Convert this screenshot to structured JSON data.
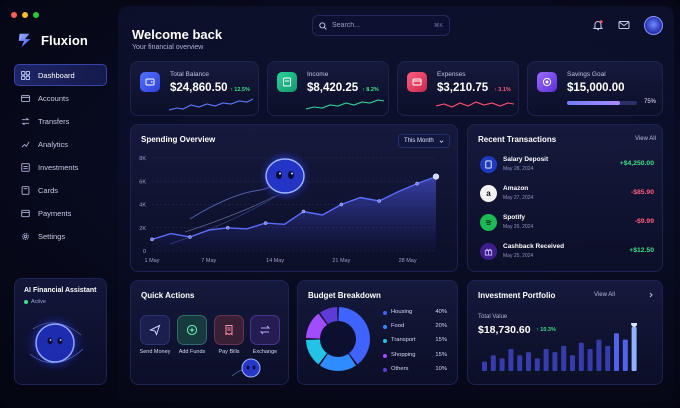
{
  "app": {
    "name": "Fluxion"
  },
  "header": {
    "welcome": "Welcome back",
    "subtitle": "Your financial overview",
    "search_placeholder": "Search...",
    "search_shortcut": "⌘K"
  },
  "sidebar": {
    "items": [
      {
        "label": "Dashboard",
        "icon": "grid-icon",
        "active": true
      },
      {
        "label": "Accounts",
        "icon": "wallet-icon"
      },
      {
        "label": "Transfers",
        "icon": "transfer-icon"
      },
      {
        "label": "Analytics",
        "icon": "chart-icon"
      },
      {
        "label": "Investments",
        "icon": "list-icon"
      },
      {
        "label": "Cards",
        "icon": "card-icon"
      },
      {
        "label": "Payments",
        "icon": "receipt-icon"
      },
      {
        "label": "Settings",
        "icon": "gear-icon"
      }
    ],
    "assistant": {
      "title": "AI Financial Assistant",
      "status": "Active"
    }
  },
  "stats": {
    "total_balance": {
      "label": "Total Balance",
      "value": "$24,860.50",
      "change": "↑ 12.5%",
      "color": "#3b5bff"
    },
    "income": {
      "label": "Income",
      "value": "$8,420.25",
      "change": "↑ 8.2%",
      "color": "#1fb98a"
    },
    "expenses": {
      "label": "Expenses",
      "value": "$3,210.75",
      "change": "↑ 3.1%",
      "color": "#e8486c"
    },
    "savings": {
      "label": "Savings Goal",
      "value": "$15,000.00",
      "percent_text": "75%",
      "progress": 0.75,
      "color": "#7a4cff"
    }
  },
  "spending": {
    "title": "Spending Overview",
    "period": "This Month",
    "chart_data": {
      "type": "area",
      "y_ticks": [
        "0",
        "2K",
        "4K",
        "6K",
        "8K"
      ],
      "x_ticks": [
        "1 May",
        "7 May",
        "14 May",
        "21 May",
        "28 May"
      ],
      "ylim": [
        0,
        8000
      ],
      "x": [
        1,
        3,
        5,
        7,
        9,
        11,
        13,
        15,
        17,
        19,
        21,
        23,
        25,
        27,
        29,
        31
      ],
      "values": [
        1000,
        1500,
        1200,
        1800,
        2000,
        1900,
        2400,
        2300,
        3400,
        3100,
        4000,
        4600,
        4300,
        5100,
        5800,
        6400
      ]
    }
  },
  "transactions": {
    "title": "Recent Transactions",
    "view_all": "View All",
    "items": [
      {
        "name": "Salary Deposit",
        "date": "May 28, 2024",
        "amount": "+$4,250.00",
        "positive": true,
        "icon": "bank-icon"
      },
      {
        "name": "Amazon",
        "date": "May 27, 2024",
        "amount": "-$85.90",
        "positive": false,
        "icon": "amazon-icon"
      },
      {
        "name": "Spotify",
        "date": "May 26, 2024",
        "amount": "-$9.99",
        "positive": false,
        "icon": "spotify-icon"
      },
      {
        "name": "Cashback Received",
        "date": "May 25, 2024",
        "amount": "+$12.50",
        "positive": true,
        "icon": "gift-icon"
      }
    ]
  },
  "quick_actions": {
    "title": "Quick Actions",
    "items": [
      {
        "label": "Send Money",
        "icon": "send-icon"
      },
      {
        "label": "Add Funds",
        "icon": "plus-circle-icon"
      },
      {
        "label": "Pay Bills",
        "icon": "bill-icon"
      },
      {
        "label": "Exchange",
        "icon": "exchange-icon"
      }
    ]
  },
  "budget": {
    "title": "Budget Breakdown",
    "chart_data": {
      "type": "pie",
      "categories": [
        "Housing",
        "Food",
        "Transport",
        "Shopping",
        "Others"
      ],
      "values": [
        40,
        20,
        15,
        15,
        10
      ],
      "labels": [
        "40%",
        "20%",
        "15%",
        "15%",
        "10%"
      ],
      "colors": [
        "#3e63ff",
        "#2f8cff",
        "#22c3e6",
        "#a14dff",
        "#5e3bd6"
      ]
    }
  },
  "portfolio": {
    "title": "Investment Portfolio",
    "view_all": "View All",
    "total_label": "Total Value",
    "total_value": "$18,730.60",
    "change": "↑ 10.3%",
    "chart_data": {
      "type": "bar",
      "values": [
        3,
        5,
        4,
        7,
        5,
        6,
        4,
        7,
        6,
        8,
        5,
        9,
        7,
        10,
        8,
        12,
        10,
        14
      ]
    }
  }
}
